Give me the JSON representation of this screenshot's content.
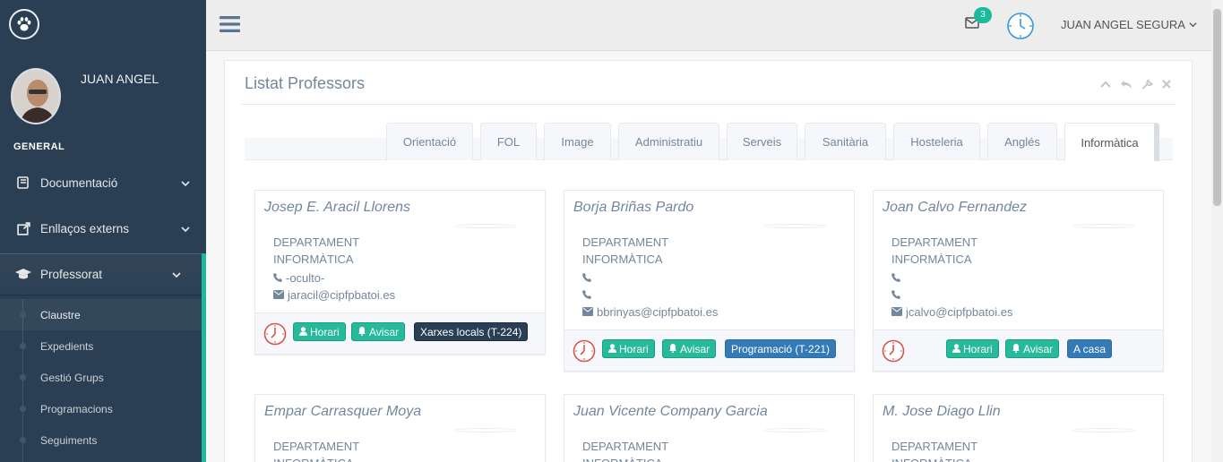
{
  "sidebar": {
    "profile_name": "JUAN ANGEL",
    "section_title": "GENERAL",
    "menu": [
      {
        "label": "Documentació"
      },
      {
        "label": "Enllaços externs"
      },
      {
        "label": "Professorat"
      }
    ],
    "submenu": [
      {
        "label": "Claustre"
      },
      {
        "label": "Expedients"
      },
      {
        "label": "Gestió Grups"
      },
      {
        "label": "Programacions"
      },
      {
        "label": "Seguiments"
      }
    ]
  },
  "topnav": {
    "notification_count": "3",
    "user_name": "JUAN ANGEL SEGURA"
  },
  "panel": {
    "title": "Listat Professors",
    "tabs": [
      {
        "label": "Orientació"
      },
      {
        "label": "FOL"
      },
      {
        "label": "Image"
      },
      {
        "label": "Administratiu"
      },
      {
        "label": "Serveis"
      },
      {
        "label": "Sanitària"
      },
      {
        "label": "Hosteleria"
      },
      {
        "label": "Anglés"
      },
      {
        "label": "Informàtica"
      }
    ],
    "active_tab": "Informàtica"
  },
  "cards": [
    {
      "name": "Josep E. Aracil Llorens",
      "dept_line1": "DEPARTAMENT",
      "dept_line2": "INFORMÀTICA",
      "phone": "-oculto-",
      "email": "jaracil@cipfpbatoi.es",
      "horari": "Horari",
      "avisar": "Avisar",
      "location": "Xarxes locals (T-224)"
    },
    {
      "name": "Borja Briñas Pardo",
      "dept_line1": "DEPARTAMENT",
      "dept_line2": "INFORMÀTICA",
      "phone": "",
      "phone2": "",
      "email": "bbrinyas@cipfpbatoi.es",
      "horari": "Horari",
      "avisar": "Avisar",
      "location": "Programació (T-221)"
    },
    {
      "name": "Joan Calvo Fernandez",
      "dept_line1": "DEPARTAMENT",
      "dept_line2": "INFORMÀTICA",
      "phone": "",
      "phone2": "",
      "email": "jcalvo@cipfpbatoi.es",
      "horari": "Horari",
      "avisar": "Avisar",
      "location": "A casa"
    },
    {
      "name": "Empar Carrasquer Moya",
      "dept_line1": "DEPARTAMENT",
      "dept_line2": "INFORMÀTICA"
    },
    {
      "name": "Juan Vicente Company Garcia",
      "dept_line1": "DEPARTAMENT",
      "dept_line2": "INFORMÀTICA"
    },
    {
      "name": "M. Jose Diago Llin",
      "dept_line1": "DEPARTAMENT",
      "dept_line2": "INFORMÀTICA"
    }
  ],
  "colors": {
    "sidebar_bg": "#2A3F54",
    "accent_green": "#1ABB9C",
    "button_green": "#26B99A",
    "button_navy": "#2A3F54",
    "button_blue": "#337AB7",
    "clock_red": "#D9534F",
    "clock_blue": "#3498DB"
  },
  "icons": {
    "logo": "paw-icon",
    "menu_toggle": "hamburger-icon",
    "mail": "envelope-icon",
    "clock": "clock-icon",
    "phone": "phone-icon",
    "email": "envelope-icon",
    "user": "user-icon",
    "bell": "bell-icon"
  }
}
